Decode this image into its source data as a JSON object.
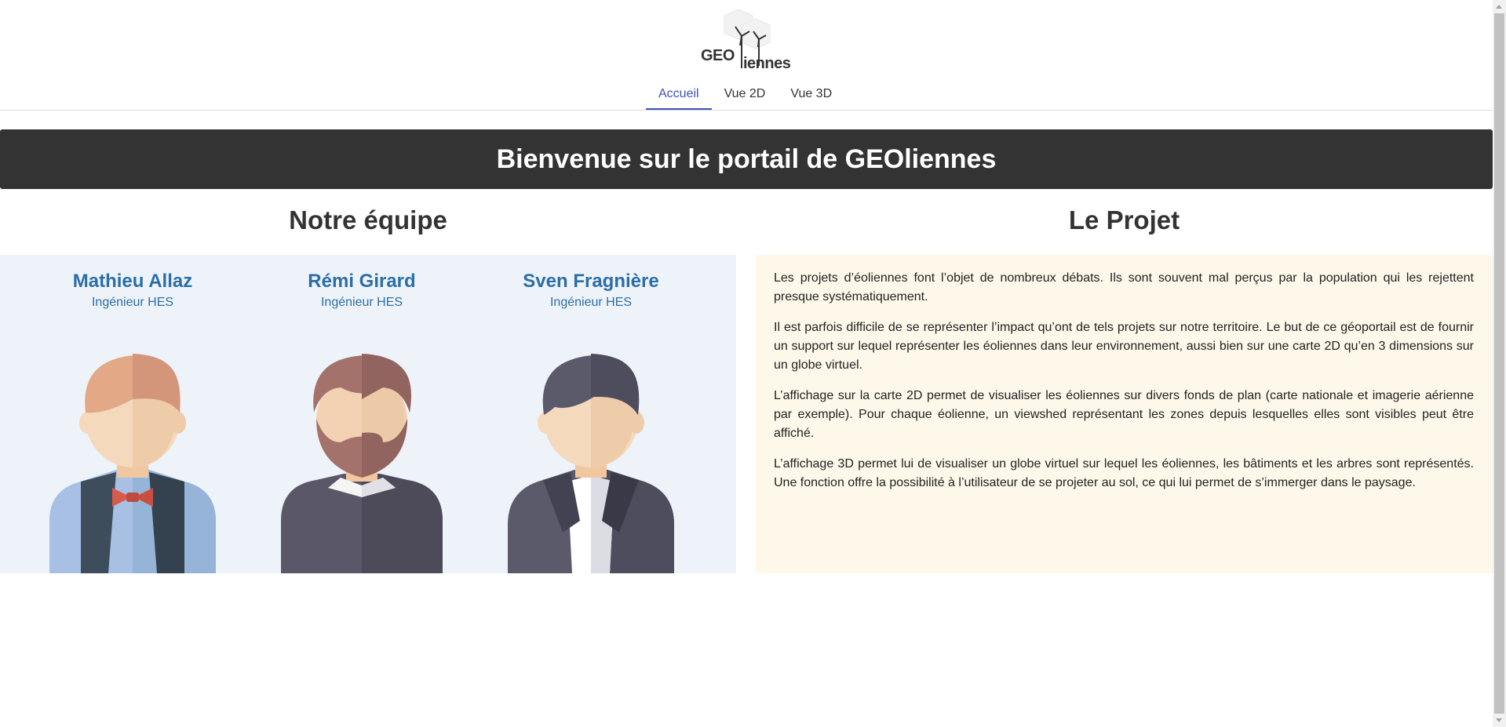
{
  "header": {
    "logo_text_left": "GEO",
    "logo_text_right": "iennes",
    "nav": [
      {
        "label": "Accueil",
        "active": true
      },
      {
        "label": "Vue 2D",
        "active": false
      },
      {
        "label": "Vue 3D",
        "active": false
      }
    ]
  },
  "banner": {
    "title": "Bienvenue sur le portail de GEOliennes"
  },
  "team": {
    "title": "Notre équipe",
    "members": [
      {
        "name": "Mathieu Allaz",
        "role": "Ingénieur HES",
        "avatar": "avatar-bowtie-icon"
      },
      {
        "name": "Rémi Girard",
        "role": "Ingénieur HES",
        "avatar": "avatar-beard-icon"
      },
      {
        "name": "Sven Fragnière",
        "role": "Ingénieur HES",
        "avatar": "avatar-suit-icon"
      }
    ]
  },
  "project": {
    "title": "Le Projet",
    "paragraphs": [
      "Les projets d’éoliennes font l’objet de nombreux débats. Ils sont souvent mal perçus par la population qui les rejettent presque systématiquement.",
      "Il est parfois difficile de se représenter l’impact qu’ont de tels projets sur notre territoire. Le but de ce géoportail est de fournir un support sur lequel représenter les éoliennes dans leur environnement, aussi bien sur une carte 2D qu’en 3 dimensions sur un globe virtuel.",
      "L’affichage sur la carte 2D permet de visualiser les éoliennes sur divers fonds de plan (carte nationale et imagerie aérienne par exemple). Pour chaque éolienne, un viewshed représentant les zones depuis lesquelles elles sont visibles peut être affiché.",
      "L’affichage 3D permet lui de visualiser un globe virtuel sur lequel les éoliennes, les bâtiments et les arbres sont représentés. Une fonction offre la possibilité à l’utilisateur de se projeter au sol, ce qui lui permet de s’immerger dans le paysage."
    ]
  },
  "colors": {
    "accent": "#3f51b5",
    "name_blue": "#2b6ea8",
    "banner_bg": "#333333",
    "team_bg": "#eef3f9",
    "project_bg": "#fdf8ea"
  }
}
